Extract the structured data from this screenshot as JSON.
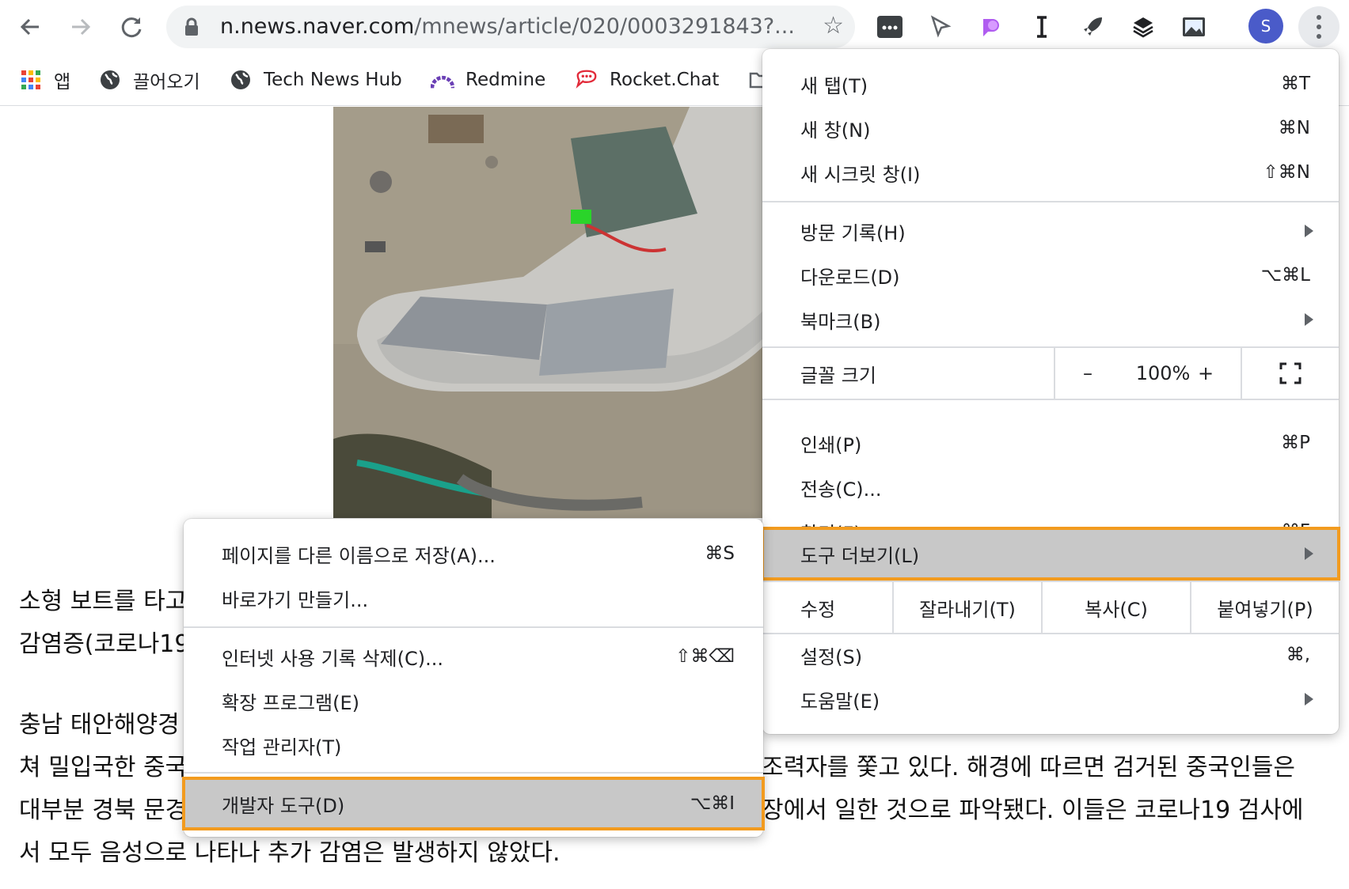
{
  "toolbar": {
    "url_host": "n.news.naver.com",
    "url_path": "/mnews/article/020/0003291843?...",
    "profile_initial": "S"
  },
  "bookmarks": [
    {
      "label": "앱",
      "icon": "apps-grid-icon"
    },
    {
      "label": "끌어오기",
      "icon": "globe-icon"
    },
    {
      "label": "Tech News Hub",
      "icon": "globe-icon"
    },
    {
      "label": "Redmine",
      "icon": "redmine-icon"
    },
    {
      "label": "Rocket.Chat",
      "icon": "rocketchat-icon"
    }
  ],
  "article": {
    "lines": [
      "소형 보트를 타고",
      "감염증(코로나19",
      "충남 태안해양경",
      "쳐 밀입국한 중국",
      "대부분 경북 문경",
      "서 모두 음성으로 나타나 추가 감염은 발생하지 않았다."
    ],
    "right_lines": [
      "조력자를 쫓고 있다. 해경에 따르면 검거된 중국인들은",
      "장에서 일한 것으로 파악됐다. 이들은 코로나19 검사에"
    ]
  },
  "main_menu": {
    "new_tab": {
      "label": "새 탭(T)",
      "shortcut": "⌘T"
    },
    "new_window": {
      "label": "새 창(N)",
      "shortcut": "⌘N"
    },
    "new_incognito": {
      "label": "새 시크릿 창(I)",
      "shortcut": "⇧⌘N"
    },
    "history": {
      "label": "방문 기록(H)"
    },
    "downloads": {
      "label": "다운로드(D)",
      "shortcut": "⌥⌘L"
    },
    "bookmarks": {
      "label": "북마크(B)"
    },
    "zoom": {
      "label": "글꼴 크기",
      "minus": "–",
      "value": "100%",
      "plus": "+"
    },
    "print": {
      "label": "인쇄(P)",
      "shortcut": "⌘P"
    },
    "cast": {
      "label": "전송(C)..."
    },
    "find": {
      "label": "찾기(F)...",
      "shortcut": "⌘F"
    },
    "more_tools": {
      "label": "도구 더보기(L)"
    },
    "edit": {
      "label": "수정",
      "cut": "잘라내기(T)",
      "copy": "복사(C)",
      "paste": "붙여넣기(P)"
    },
    "settings": {
      "label": "설정(S)",
      "shortcut": "⌘,"
    },
    "help": {
      "label": "도움말(E)"
    }
  },
  "sub_menu": {
    "save_as": {
      "label": "페이지를 다른 이름으로 저장(A)...",
      "shortcut": "⌘S"
    },
    "create_shortcut": {
      "label": "바로가기 만들기..."
    },
    "clear_data": {
      "label": "인터넷 사용 기록 삭제(C)...",
      "shortcut": "⇧⌘⌫"
    },
    "extensions": {
      "label": "확장 프로그램(E)"
    },
    "task_manager": {
      "label": "작업 관리자(T)"
    },
    "dev_tools": {
      "label": "개발자 도구(D)",
      "shortcut": "⌥⌘I"
    }
  },
  "colors": {
    "highlight": "#c8c8c8",
    "focus_outline": "#f29b1f",
    "profile": "#4a5bc9"
  }
}
